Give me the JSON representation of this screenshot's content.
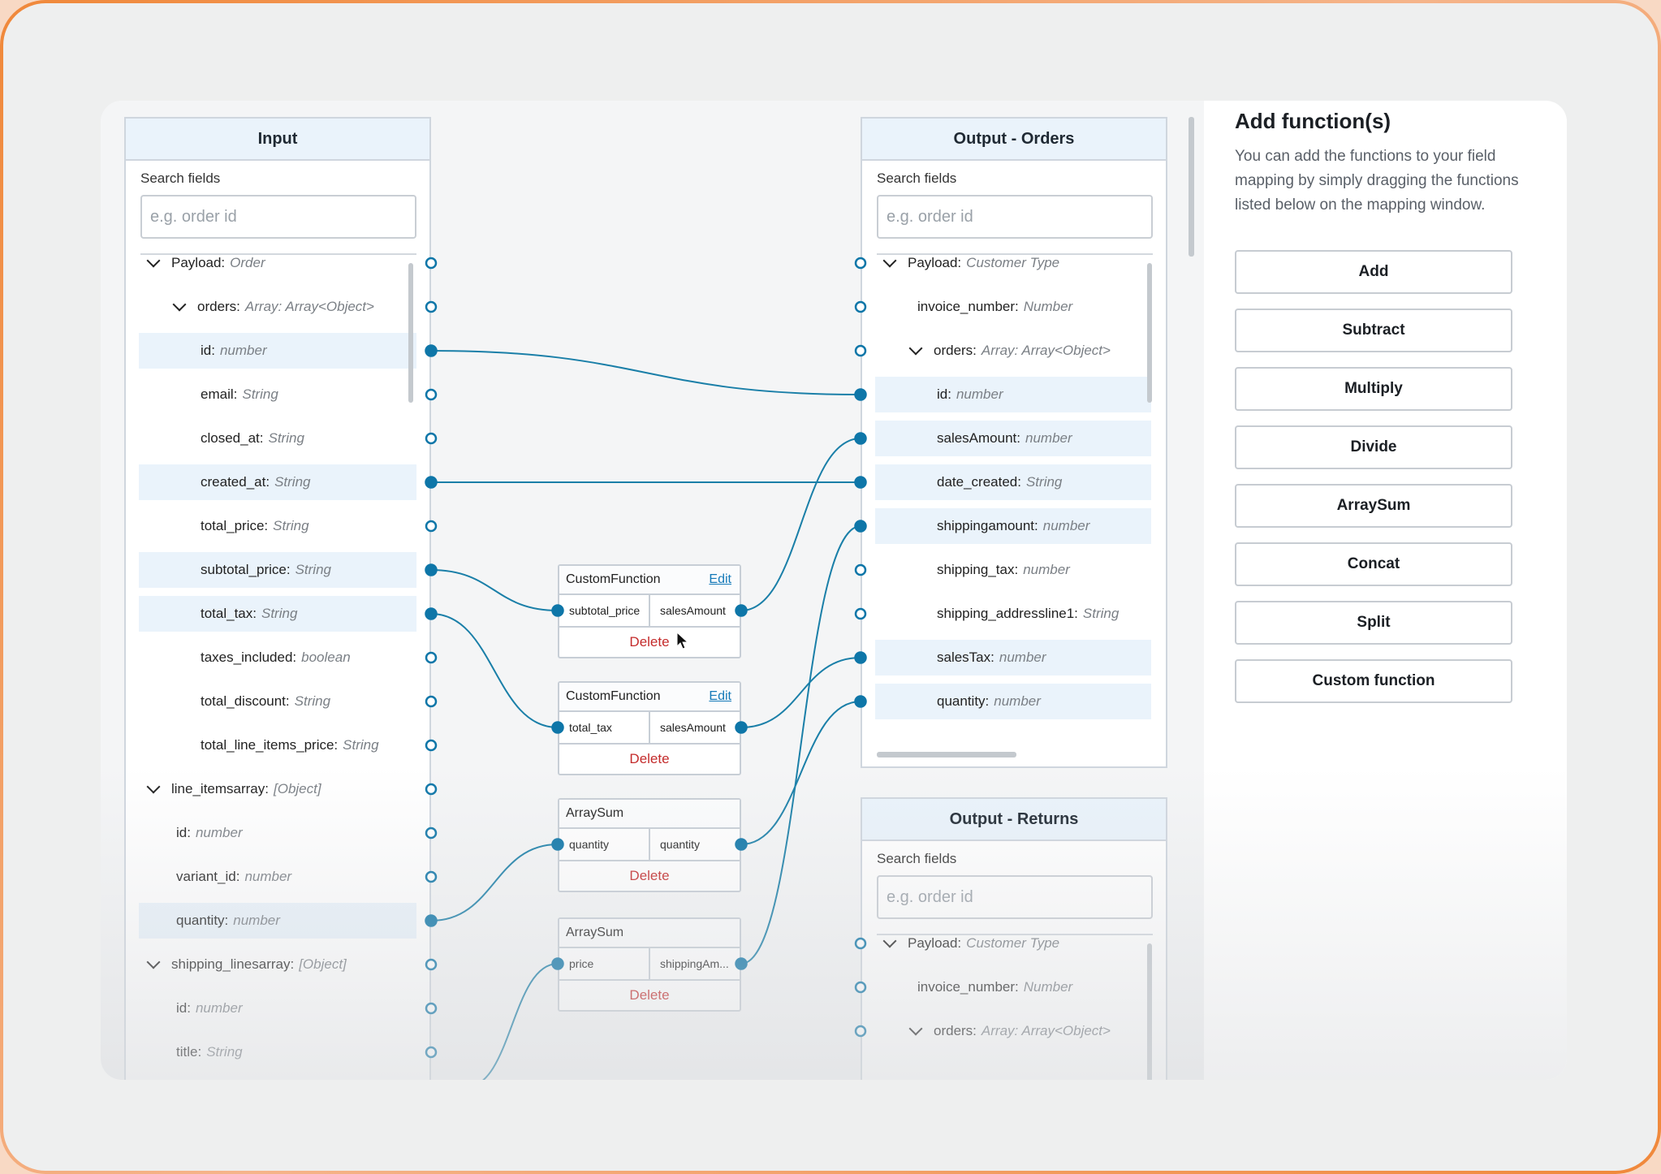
{
  "input_panel": {
    "title": "Input",
    "search_label": "Search fields",
    "search_placeholder": "e.g. order id",
    "fields": [
      {
        "name": "Payload:",
        "type": "Order",
        "indent": 0,
        "chevron": true
      },
      {
        "name": "orders:",
        "type": "Array: Array<Object>",
        "indent": 1,
        "chevron": true
      },
      {
        "name": "id:",
        "type": "number",
        "indent": 2,
        "chevron": false,
        "hl": true,
        "connected": true
      },
      {
        "name": "email:",
        "type": "String",
        "indent": 2,
        "chevron": false
      },
      {
        "name": "closed_at:",
        "type": "String",
        "indent": 2,
        "chevron": false
      },
      {
        "name": "created_at:",
        "type": "String",
        "indent": 2,
        "chevron": false,
        "hl": true,
        "connected": true
      },
      {
        "name": "total_price:",
        "type": "String",
        "indent": 2,
        "chevron": false
      },
      {
        "name": "subtotal_price:",
        "type": "String",
        "indent": 2,
        "chevron": false,
        "hl": true,
        "connected": true
      },
      {
        "name": "total_tax:",
        "type": "String",
        "indent": 2,
        "chevron": false,
        "hl": true,
        "connected": true
      },
      {
        "name": "taxes_included:",
        "type": "boolean",
        "indent": 2,
        "chevron": false
      },
      {
        "name": "total_discount:",
        "type": "String",
        "indent": 2,
        "chevron": false
      },
      {
        "name": "total_line_items_price:",
        "type": "String",
        "indent": 2,
        "chevron": false
      },
      {
        "name": "line_itemsarray:",
        "type": "[Object]",
        "indent": 0,
        "chevron": true
      },
      {
        "name": "id:",
        "type": "number",
        "indent": 3,
        "chevron": false
      },
      {
        "name": "variant_id:",
        "type": "number",
        "indent": 3,
        "chevron": false
      },
      {
        "name": "quantity:",
        "type": "number",
        "indent": 3,
        "chevron": false,
        "hl": true,
        "connected": true
      },
      {
        "name": "shipping_linesarray:",
        "type": "[Object]",
        "indent": 0,
        "chevron": true
      },
      {
        "name": "id:",
        "type": "number",
        "indent": 3,
        "chevron": false
      },
      {
        "name": "title:",
        "type": "String",
        "indent": 3,
        "chevron": false
      }
    ]
  },
  "output_orders_panel": {
    "title": "Output - Orders",
    "search_label": "Search fields",
    "search_placeholder": "e.g. order id",
    "fields": [
      {
        "name": "Payload:",
        "type": "Customer Type",
        "indent": 0,
        "chevron": true
      },
      {
        "name": "invoice_number:",
        "type": "Number",
        "indent": 1,
        "chevron": false
      },
      {
        "name": "orders:",
        "type": "Array: Array<Object>",
        "indent": 1,
        "chevron": true
      },
      {
        "name": "id:",
        "type": "number",
        "indent": 2,
        "chevron": false,
        "hl": true,
        "connected": true
      },
      {
        "name": "salesAmount:",
        "type": "number",
        "indent": 2,
        "chevron": false,
        "hl": true,
        "connected": true
      },
      {
        "name": "date_created:",
        "type": "String",
        "indent": 2,
        "chevron": false,
        "hl": true,
        "connected": true
      },
      {
        "name": "shippingamount:",
        "type": "number",
        "indent": 2,
        "chevron": false,
        "hl": true,
        "connected": true
      },
      {
        "name": "shipping_tax:",
        "type": "number",
        "indent": 2,
        "chevron": false
      },
      {
        "name": "shipping_addressline1:",
        "type": "String",
        "indent": 2,
        "chevron": false
      },
      {
        "name": "salesTax:",
        "type": "number",
        "indent": 2,
        "chevron": false,
        "hl": true,
        "connected": true
      },
      {
        "name": "quantity:",
        "type": "number",
        "indent": 2,
        "chevron": false,
        "hl": true,
        "connected": true
      }
    ]
  },
  "output_returns_panel": {
    "title": "Output - Returns",
    "search_label": "Search fields",
    "search_placeholder": "e.g. order id",
    "fields": [
      {
        "name": "Payload:",
        "type": "Customer Type",
        "indent": 0,
        "chevron": true
      },
      {
        "name": "invoice_number:",
        "type": "Number",
        "indent": 1,
        "chevron": false
      },
      {
        "name": "orders:",
        "type": "Array: Array<Object>",
        "indent": 1,
        "chevron": true
      }
    ]
  },
  "functions": [
    {
      "title": "CustomFunction",
      "edit": "Edit",
      "in": "subtotal_price",
      "out": "salesAmount",
      "delete": "Delete"
    },
    {
      "title": "CustomFunction",
      "edit": "Edit",
      "in": "total_tax",
      "out": "salesAmount",
      "delete": "Delete"
    },
    {
      "title": "ArraySum",
      "edit": "",
      "in": "quantity",
      "out": "quantity",
      "delete": "Delete"
    },
    {
      "title": "ArraySum",
      "edit": "",
      "in": "price",
      "out": "shippingAm...",
      "delete": "Delete"
    }
  ],
  "sidebar": {
    "title": "Add function(s)",
    "description": "You can add the functions to your field mapping by simply dragging the functions listed below on the mapping window.",
    "buttons": [
      "Add",
      "Subtract",
      "Multiply",
      "Divide",
      "ArraySum",
      "Concat",
      "Split",
      "Custom function"
    ]
  },
  "colors": {
    "wire": "#1a7fa8",
    "port": "#0e76a8",
    "highlight": "#eaf3fb",
    "delete": "#c42b2b"
  }
}
